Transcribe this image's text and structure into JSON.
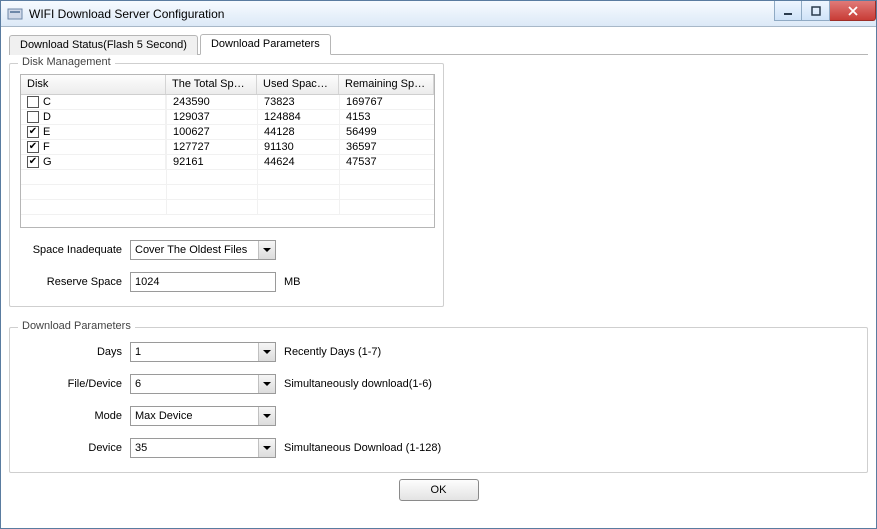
{
  "window": {
    "title": "WIFI Download Server Configuration"
  },
  "tabs": {
    "status": {
      "label": "Download Status(Flash 5 Second)"
    },
    "params": {
      "label": "Download Parameters"
    }
  },
  "diskGroup": {
    "legend": "Disk Management",
    "headers": {
      "disk": "Disk",
      "total": "The Total Spac…",
      "used": "Used Space(MB)",
      "remain": "Remaining Spac…"
    },
    "rows": [
      {
        "name": "C",
        "total": "243590",
        "used": "73823",
        "remain": "169767",
        "checked": false
      },
      {
        "name": "D",
        "total": "129037",
        "used": "124884",
        "remain": "4153",
        "checked": false
      },
      {
        "name": "E",
        "total": "100627",
        "used": "44128",
        "remain": "56499",
        "checked": true
      },
      {
        "name": "F",
        "total": "127727",
        "used": "91130",
        "remain": "36597",
        "checked": true
      },
      {
        "name": "G",
        "total": "92161",
        "used": "44624",
        "remain": "47537",
        "checked": true
      }
    ],
    "spaceInadequate": {
      "label": "Space Inadequate",
      "value": "Cover The Oldest Files"
    },
    "reserveSpace": {
      "label": "Reserve Space",
      "value": "1024",
      "unit": "MB"
    }
  },
  "paramsGroup": {
    "legend": "Download Parameters",
    "days": {
      "label": "Days",
      "value": "1",
      "hint": "Recently Days (1-7)"
    },
    "file": {
      "label": "File/Device",
      "value": "6",
      "hint": "Simultaneously download(1-6)"
    },
    "mode": {
      "label": "Mode",
      "value": "Max Device",
      "hint": ""
    },
    "device": {
      "label": "Device",
      "value": "35",
      "hint": "Simultaneous Download (1-128)"
    }
  },
  "ok": {
    "label": "OK"
  }
}
